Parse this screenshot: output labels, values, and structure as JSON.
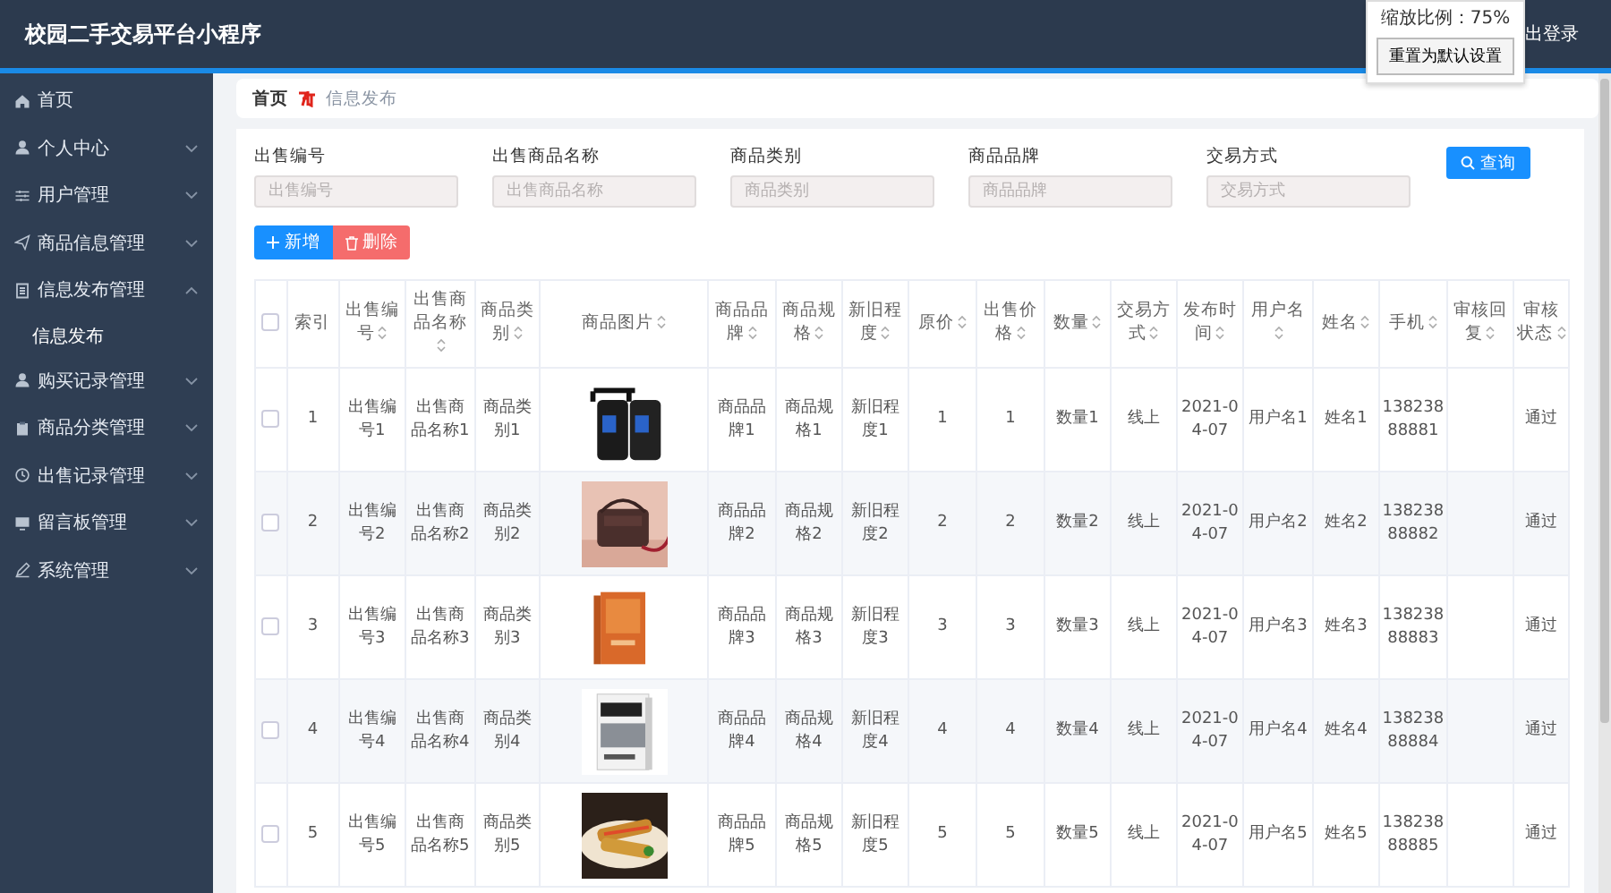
{
  "header": {
    "title": "校园二手交易平台小程序",
    "logout": "出登录"
  },
  "zoom_popup": {
    "label": "缩放比例：75%",
    "button": "重置为默认设置"
  },
  "sidebar": {
    "items": [
      {
        "label": "首页",
        "has_children": false
      },
      {
        "label": "个人中心",
        "expanded": false,
        "has_children": true
      },
      {
        "label": "用户管理",
        "expanded": false,
        "has_children": true
      },
      {
        "label": "商品信息管理",
        "expanded": false,
        "has_children": true
      },
      {
        "label": "信息发布管理",
        "expanded": true,
        "has_children": true,
        "children": [
          {
            "label": "信息发布"
          }
        ]
      },
      {
        "label": "购买记录管理",
        "expanded": false,
        "has_children": true
      },
      {
        "label": "商品分类管理",
        "expanded": false,
        "has_children": true
      },
      {
        "label": "出售记录管理",
        "expanded": false,
        "has_children": true
      },
      {
        "label": "留言板管理",
        "expanded": false,
        "has_children": true
      },
      {
        "label": "系统管理",
        "expanded": false,
        "has_children": true
      }
    ]
  },
  "breadcrumb": {
    "home": "首页",
    "current": "信息发布"
  },
  "filters": [
    {
      "label": "出售编号",
      "placeholder": "出售编号"
    },
    {
      "label": "出售商品名称",
      "placeholder": "出售商品名称"
    },
    {
      "label": "商品类别",
      "placeholder": "商品类别"
    },
    {
      "label": "商品品牌",
      "placeholder": "商品品牌"
    },
    {
      "label": "交易方式",
      "placeholder": "交易方式"
    }
  ],
  "search_button": "查询",
  "actions": {
    "add": "新增",
    "delete": "删除"
  },
  "table": {
    "header_checked": false,
    "columns": [
      "索引",
      "出售编号",
      "出售商品名称",
      "商品类别",
      "商品图片",
      "商品品牌",
      "商品规格",
      "新旧程度",
      "原价",
      "出售价格",
      "数量",
      "交易方式",
      "发布时间",
      "用户名",
      "姓名",
      "手机",
      "审核回复",
      "审核状态"
    ],
    "rows": [
      {
        "checked": false,
        "index": "1",
        "sale_no": "出售编号1",
        "name": "出售商品名称1",
        "category": "商品类别1",
        "brand": "商品品牌1",
        "spec": "商品规格1",
        "condition": "新旧程度1",
        "original_price": "1",
        "price": "1",
        "quantity": "数量1",
        "trade": "线上",
        "time": "2021-04-07",
        "username": "用户名1",
        "real_name": "姓名1",
        "phone": "13823888881",
        "status": "通过"
      },
      {
        "checked": false,
        "index": "2",
        "sale_no": "出售编号2",
        "name": "出售商品名称2",
        "category": "商品类别2",
        "brand": "商品品牌2",
        "spec": "商品规格2",
        "condition": "新旧程度2",
        "original_price": "2",
        "price": "2",
        "quantity": "数量2",
        "trade": "线上",
        "time": "2021-04-07",
        "username": "用户名2",
        "real_name": "姓名2",
        "phone": "13823888882",
        "status": "通过"
      },
      {
        "checked": false,
        "index": "3",
        "sale_no": "出售编号3",
        "name": "出售商品名称3",
        "category": "商品类别3",
        "brand": "商品品牌3",
        "spec": "商品规格3",
        "condition": "新旧程度3",
        "original_price": "3",
        "price": "3",
        "quantity": "数量3",
        "trade": "线上",
        "time": "2021-04-07",
        "username": "用户名3",
        "real_name": "姓名3",
        "phone": "13823888883",
        "status": "通过"
      },
      {
        "checked": false,
        "index": "4",
        "sale_no": "出售编号4",
        "name": "出售商品名称4",
        "category": "商品类别4",
        "brand": "商品品牌4",
        "spec": "商品规格4",
        "condition": "新旧程度4",
        "original_price": "4",
        "price": "4",
        "quantity": "数量4",
        "trade": "线上",
        "time": "2021-04-07",
        "username": "用户名4",
        "real_name": "姓名4",
        "phone": "13823888884",
        "status": "通过"
      },
      {
        "checked": false,
        "index": "5",
        "sale_no": "出售编号5",
        "name": "出售商品名称5",
        "category": "商品类别5",
        "brand": "商品品牌5",
        "spec": "商品规格5",
        "condition": "新旧程度5",
        "original_price": "5",
        "price": "5",
        "quantity": "数量5",
        "trade": "线上",
        "time": "2021-04-07",
        "username": "用户名5",
        "real_name": "姓名5",
        "phone": "13823888885",
        "status": "通过"
      }
    ]
  }
}
